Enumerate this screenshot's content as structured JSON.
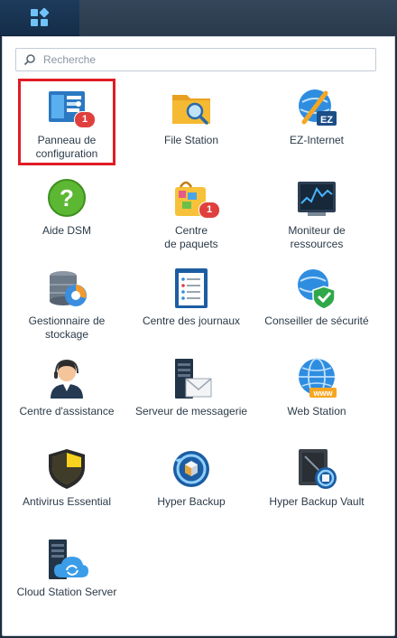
{
  "search": {
    "placeholder": "Recherche"
  },
  "apps": [
    {
      "id": "panneau",
      "label": "Panneau de\nconfiguration",
      "icon": "control-panel-icon",
      "badge": "1"
    },
    {
      "id": "filestation",
      "label": "File Station",
      "icon": "file-station-icon"
    },
    {
      "id": "ezinternet",
      "label": "EZ-Internet",
      "icon": "ez-internet-icon"
    },
    {
      "id": "aide",
      "label": "Aide DSM",
      "icon": "help-icon"
    },
    {
      "id": "paquets",
      "label": "Centre\nde paquets",
      "icon": "package-center-icon",
      "badge": "1"
    },
    {
      "id": "moniteur",
      "label": "Moniteur de\nressources",
      "icon": "resource-monitor-icon"
    },
    {
      "id": "stockage",
      "label": "Gestionnaire de\nstockage",
      "icon": "storage-manager-icon"
    },
    {
      "id": "journaux",
      "label": "Centre des journaux",
      "icon": "log-center-icon"
    },
    {
      "id": "securite",
      "label": "Conseiller de sécurité",
      "icon": "security-advisor-icon"
    },
    {
      "id": "assistance",
      "label": "Centre d'assistance",
      "icon": "support-center-icon"
    },
    {
      "id": "messagerie",
      "label": "Serveur de messagerie",
      "icon": "mail-server-icon"
    },
    {
      "id": "webstation",
      "label": "Web Station",
      "icon": "web-station-icon"
    },
    {
      "id": "antivirus",
      "label": "Antivirus Essential",
      "icon": "antivirus-icon"
    },
    {
      "id": "hyperbackup",
      "label": "Hyper Backup",
      "icon": "hyper-backup-icon"
    },
    {
      "id": "hbvault",
      "label": "Hyper Backup Vault",
      "icon": "hyper-backup-vault-icon"
    },
    {
      "id": "cloudstation",
      "label": "Cloud Station Server",
      "icon": "cloud-station-server-icon"
    }
  ]
}
